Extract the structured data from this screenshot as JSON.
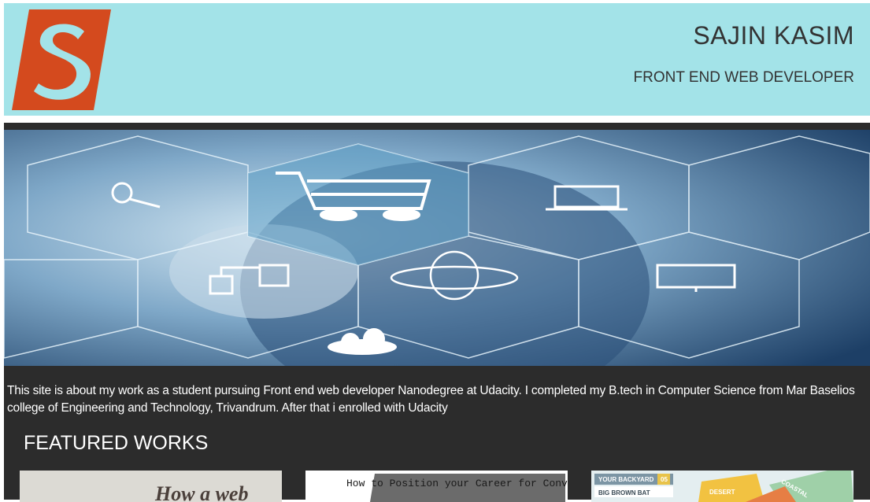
{
  "header": {
    "name": "SAJIN KASIM",
    "role": "FRONT END WEB DEVELOPER",
    "logo_letter": "S",
    "logo_color": "#d44a1e",
    "background": "#a3e3e8"
  },
  "hero": {
    "icons": [
      "search-icon",
      "shopping-cart-icon",
      "laptop-icon",
      "tablet-phone-icon",
      "globe-icon",
      "monitor-icon",
      "cloud-icon"
    ]
  },
  "about": {
    "text": "This site is about my work as a student pursuing Front end web developer Nanodegree at Udacity. I completed my B.tech in Computer Science from Mar Baselios college of Engineering and Technology, Trivandrum. After that i enrolled with Udacity"
  },
  "featured": {
    "heading": "FEATURED WORKS",
    "works": [
      {
        "caption": "How a web"
      },
      {
        "caption": "How to Position your Career for Convulsive Economic Cycles"
      },
      {
        "caption": "YOUR BACKYARD",
        "sub": "BIG BROWN BAT",
        "tag1": "DESERT",
        "tag2": "COASTAL",
        "num": "05"
      }
    ]
  }
}
